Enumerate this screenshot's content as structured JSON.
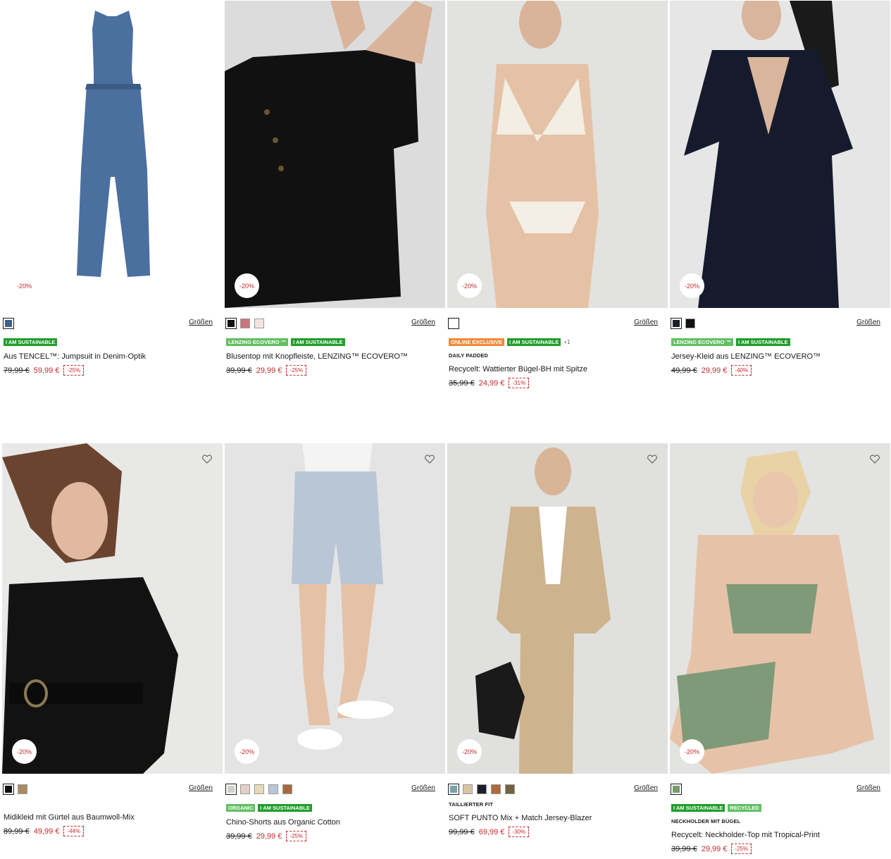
{
  "sizes_label": "Größen",
  "colors": {
    "accent": "#c8272d",
    "badge_green": "#1f9e2a",
    "badge_light_green": "#61bf62",
    "badge_orange": "#f08a3a"
  },
  "products": [
    {
      "discount_circle": "-20%",
      "swatches": [
        "#3c5f8e"
      ],
      "badges": [
        {
          "text": "I AM SUSTAINABLE",
          "color": "green"
        }
      ],
      "badge_more": "",
      "feature": "",
      "title": "Aus TENCEL™: Jumpsuit in Denim-Optik",
      "old_price": "79,99 €",
      "new_price": "59,99 €",
      "percent": "-25%",
      "photo": "jumpsuit",
      "wishlist": false
    },
    {
      "discount_circle": "-20%",
      "swatches": [
        "#111111",
        "#c9767e",
        "#f3e3e1"
      ],
      "badges": [
        {
          "text": "LENZING ECOVERO ™",
          "color": "lgreen"
        },
        {
          "text": "I AM SUSTAINABLE",
          "color": "green"
        }
      ],
      "badge_more": "",
      "feature": "",
      "title": "Blusentop mit Knopfleiste, LENZING™ ECOVERO™",
      "old_price": "39,99 €",
      "new_price": "29,99 €",
      "percent": "-25%",
      "photo": "blouse",
      "wishlist": false
    },
    {
      "discount_circle": "-20%",
      "swatches": [
        "#ffffff"
      ],
      "badges": [
        {
          "text": "ONLINE EXCLUSIVE",
          "color": "orange"
        },
        {
          "text": "I AM SUSTAINABLE",
          "color": "green"
        }
      ],
      "badge_more": "+1",
      "feature": "DAILY PADDED",
      "title": "Recycelt: Wattierter Bügel-BH mit Spitze",
      "old_price": "35,99 €",
      "new_price": "24,99 €",
      "percent": "-31%",
      "photo": "bra",
      "wishlist": false
    },
    {
      "discount_circle": "-20%",
      "swatches": [
        "#1b1f2b",
        "#111111"
      ],
      "badges": [
        {
          "text": "LENZING ECOVERO ™",
          "color": "lgreen"
        },
        {
          "text": "I AM SUSTAINABLE",
          "color": "green"
        }
      ],
      "badge_more": "",
      "feature": "",
      "title": "Jersey-Kleid aus LENZING™ ECOVERO™",
      "old_price": "49,99 €",
      "new_price": "29,99 €",
      "percent": "-40%",
      "photo": "wrapdress",
      "wishlist": false
    },
    {
      "discount_circle": "-20%",
      "swatches": [
        "#111111",
        "#a98a63"
      ],
      "badges": [],
      "badge_more": "",
      "feature": "",
      "title": "Midikleid mit Gürtel aus Baumwoll-Mix",
      "old_price": "89,99 €",
      "new_price": "49,99 €",
      "percent": "-44%",
      "photo": "midi",
      "wishlist": true
    },
    {
      "discount_circle": "-20%",
      "swatches": [
        "#cfcfcb",
        "#e3cfc9",
        "#e8d9b6",
        "#b7c7d9",
        "#a6693e"
      ],
      "badges": [
        {
          "text": "ORGANIC",
          "color": "lgreen"
        },
        {
          "text": "I AM SUSTAINABLE",
          "color": "green"
        }
      ],
      "badge_more": "",
      "feature": "",
      "title": "Chino-Shorts aus Organic Cotton",
      "old_price": "39,99 €",
      "new_price": "29,99 €",
      "percent": "-25%",
      "photo": "shorts",
      "wishlist": true
    },
    {
      "discount_circle": "-20%",
      "swatches": [
        "#7aa3a9",
        "#d7c4a1",
        "#1b1f2b",
        "#b0693b",
        "#6f6343"
      ],
      "badges": [],
      "badge_more": "",
      "feature": "TAILLIERTER FIT",
      "title": "SOFT PUNTO Mix + Match Jersey-Blazer",
      "old_price": "99,99 €",
      "new_price": "69,99 €",
      "percent": "-30%",
      "photo": "blazer",
      "wishlist": true
    },
    {
      "discount_circle": "-20%",
      "swatches": [
        "#7a9a6f"
      ],
      "badges": [
        {
          "text": "I AM SUSTAINABLE",
          "color": "green"
        },
        {
          "text": "RECYCLED",
          "color": "lgreen"
        }
      ],
      "badge_more": "",
      "feature": "NECKHOLDER MIT BÜGEL",
      "title": "Recycelt: Neckholder-Top mit Tropical-Print",
      "old_price": "39,99 €",
      "new_price": "29,99 €",
      "percent": "-25%",
      "photo": "bikini",
      "wishlist": true
    }
  ]
}
